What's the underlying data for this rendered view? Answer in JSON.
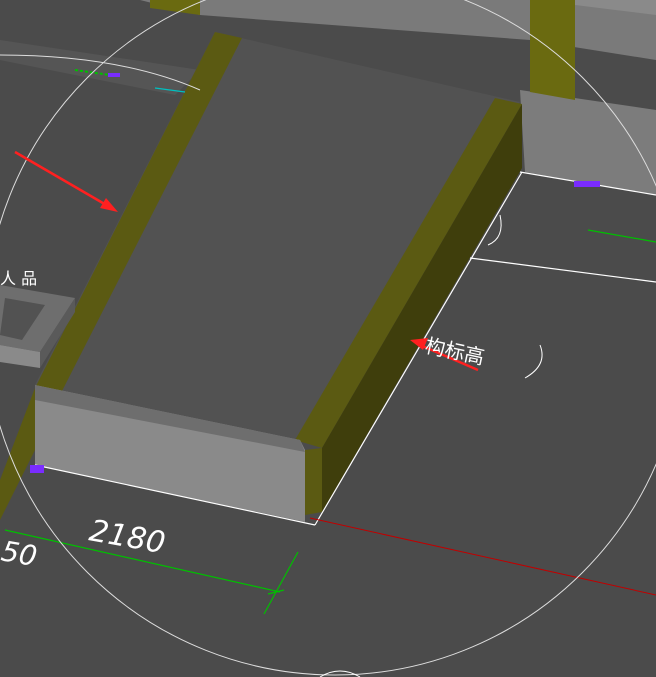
{
  "viewport": {
    "background": "#4a4a4a",
    "dimension_label": "2180",
    "dimension_label_partial": "50",
    "elevation_label_partial": "构标高",
    "room_label_partial": "人 品"
  },
  "colors": {
    "floor": "#4b4b4b",
    "slab_top": "#525252",
    "slab_side": "#6e6e6e",
    "beam_olive": "#5b5a12",
    "beam_olive_dark": "#3f3e0c",
    "wall_top": "#7a7a7a",
    "wall_side": "#8a8a8a",
    "dimension_green": "#00c000",
    "axis_red": "#c00000",
    "arrow_red": "#ff2020",
    "edge_white": "#ffffff",
    "marker_purple": "#7a2cff"
  }
}
